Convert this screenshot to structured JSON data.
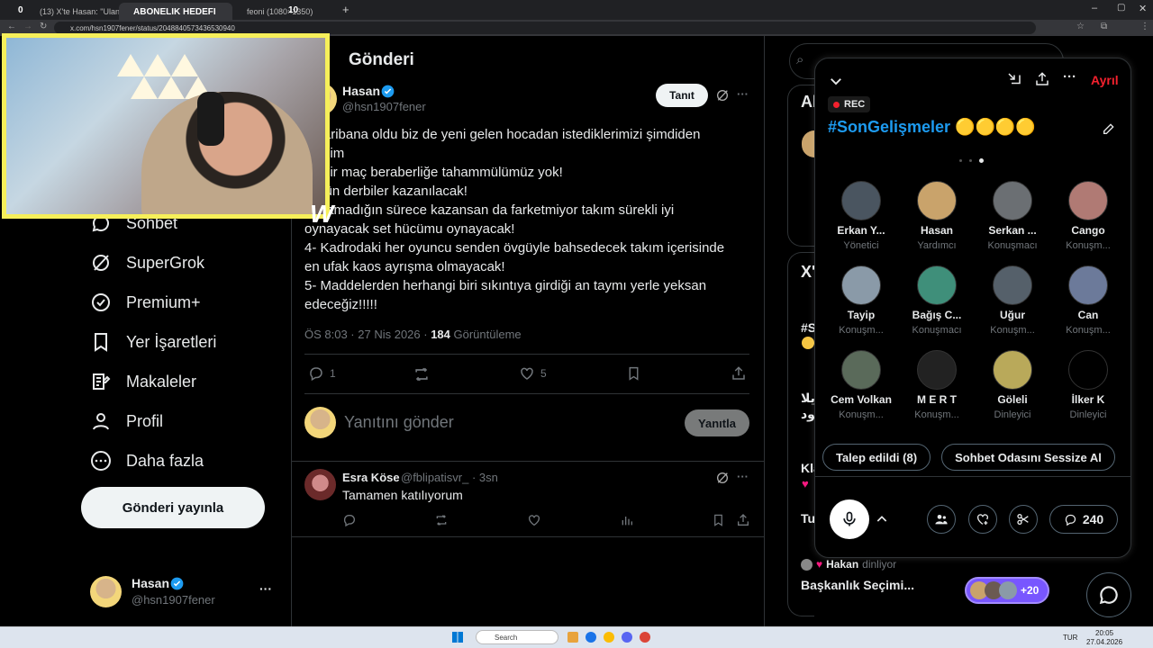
{
  "browser": {
    "tabs": [
      {
        "label": "(13) X'te Hasan: \"Ulan garib..."
      },
      {
        "label": "ABONELIK HEDEFI"
      },
      {
        "label": "feoni (1080×1350)"
      }
    ],
    "tab_counter_left": "0",
    "tab_counter_right": "10",
    "url": "x.com/hsn1907fener/status/2048840573436530940"
  },
  "sidebar": {
    "items": [
      {
        "label": "Sohbet"
      },
      {
        "label": "SuperGrok"
      },
      {
        "label": "Premium+"
      },
      {
        "label": "Yer İşaretleri"
      },
      {
        "label": "Makaleler"
      },
      {
        "label": "Profil"
      },
      {
        "label": "Daha fazla"
      }
    ],
    "post_button": "Gönderi yayınla",
    "account_name": "Hasan",
    "account_handle": "@hsn1907fener",
    "more": "···"
  },
  "main": {
    "header": "Gönderi",
    "author_name": "Hasan",
    "author_handle": "@hsn1907fener",
    "follow_button": "Tanıt",
    "tweet_lines": [
      "n garibana oldu biz de yeni gelen hocadan istediklerimizi şimdiden",
      " edelim",
      "ek bir maç beraberliğe tahammülümüz yok!",
      "Bütün derbiler kazanılacak!",
      "oynamadığın sürece kazansan da farketmiyor takım sürekli iyi",
      "oynayacak set hücümu oynayacak!",
      "4- Kadrodaki her oyuncu senden övgüyle bahsedecek takım içerisinde",
      "en ufak kaos ayrışma olmayacak!",
      "5- Maddelerden herhangi biri sıkıntıya girdiği an taymı yerle yeksan",
      "edeceğiz!!!!!"
    ],
    "timestamp": "ÖS 8:03 · 27 Nis 2026 · ",
    "views_count": "184",
    "views_label": " Görüntüleme",
    "replies": "1",
    "likes": "5",
    "reply_placeholder": "Yanıtını gönder",
    "reply_button": "Yanıtla",
    "reply": {
      "name": "Esra Köse",
      "handle": "@fblipatisvr_ · 3sn",
      "text": "Tamamen katılıyorum"
    }
  },
  "right": {
    "partial_1": "Al",
    "partial_2": "X'",
    "partial_3": "#S",
    "partial_4": "يلا",
    "partial_5": "يود",
    "partial_6": "Kla",
    "partial_7": "Tu",
    "listener_name": "Hakan",
    "listener_suffix": " dinliyor",
    "space_title": "Başkanlık Seçimi...",
    "listener_count": "+20"
  },
  "spaces": {
    "leave": "Ayrıl",
    "rec": "REC",
    "title": "#SonGelişmeler 🟡🟡🟡🟡",
    "participants": [
      {
        "name": "Erkan Y...",
        "role": "Yönetici",
        "color": "#4a5560"
      },
      {
        "name": "Hasan",
        "role": "Yardımcı",
        "color": "#c9a36b"
      },
      {
        "name": "Serkan ...",
        "role": "Konuşmacı",
        "color": "#6b6f73"
      },
      {
        "name": "Cango",
        "role": "Konuşm...",
        "color": "#b07a74"
      },
      {
        "name": "Tayip",
        "role": "Konuşm...",
        "color": "#8a9aa8"
      },
      {
        "name": "Bağış C...",
        "role": "Konuşmacı",
        "color": "#3f8f7a"
      },
      {
        "name": "Uğur",
        "role": "Konuşm...",
        "color": "#55606a"
      },
      {
        "name": "Can",
        "role": "Konuşm...",
        "color": "#6c7a9a"
      },
      {
        "name": "Cem Volkan",
        "role": "Konuşm...",
        "color": "#5a6a5a"
      },
      {
        "name": "M E R T",
        "role": "Konuşm...",
        "color": "#222"
      },
      {
        "name": "Göleli",
        "role": "Dinleyici",
        "color": "#b9a95a"
      },
      {
        "name": "İlker K",
        "role": "Dinleyici",
        "color": "#000"
      }
    ],
    "request_button": "Talep edildi (8)",
    "mute_button": "Sohbet Odasını Sessize Al",
    "comment_count": "240"
  },
  "taskbar": {
    "search": "Search",
    "lang": "TUR",
    "time": "20:05",
    "date": "27.04.2026"
  },
  "colors": {
    "accent": "#1d9bf0",
    "webcam_border": "#f6ef5a",
    "leave": "#f4212e"
  }
}
